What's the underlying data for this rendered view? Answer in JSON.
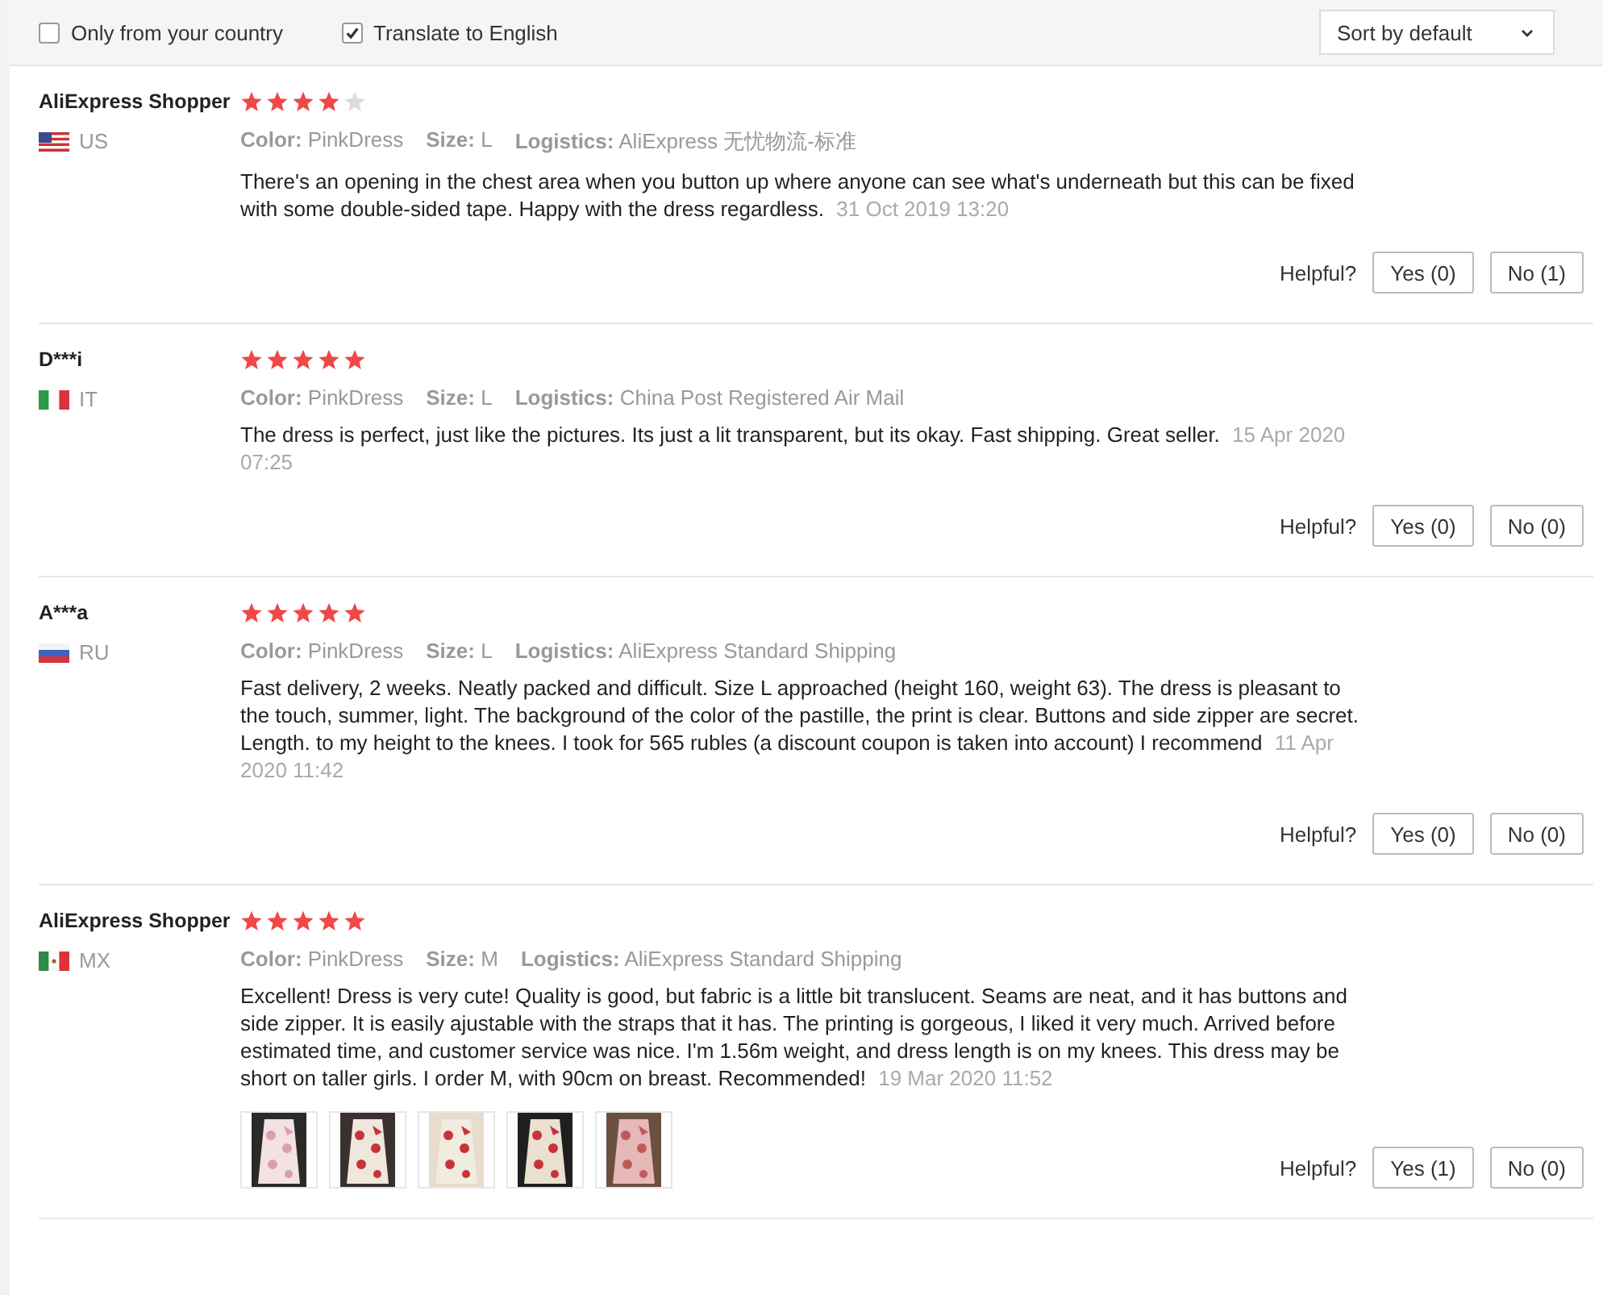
{
  "filters": [
    {
      "label": "Only from your country",
      "checked": false
    },
    {
      "label": "Translate to English",
      "checked": true
    }
  ],
  "sort": {
    "value": "Sort by default"
  },
  "reviews": [
    {
      "name": "AliExpress Shopper",
      "country": "US",
      "stars": 4,
      "details": [
        {
          "label": "Color:",
          "value": "PinkDress"
        },
        {
          "label": "Size:",
          "value": "L"
        },
        {
          "label": "Logistics:",
          "value": "AliExpress 无忧物流-标准"
        }
      ],
      "text": "There's an opening in the chest area when you button up where anyone can see what's underneath but this can be fixed with some double-sided tape. Happy with the dress regardless.",
      "date": "31 Oct 2019 13:20",
      "helpful_label": "Helpful?",
      "yes": "Yes (0)",
      "no": "No (1)"
    },
    {
      "name": "D***i",
      "country": "IT",
      "stars": 5,
      "details": [
        {
          "label": "Color:",
          "value": "PinkDress"
        },
        {
          "label": "Size:",
          "value": "L"
        },
        {
          "label": "Logistics:",
          "value": "China Post Registered Air Mail"
        }
      ],
      "text": "The dress is perfect, just like the pictures. Its just a lit transparent, but its okay. Fast shipping. Great seller.",
      "date": "15 Apr 2020 07:25",
      "helpful_label": "Helpful?",
      "yes": "Yes (0)",
      "no": "No (0)"
    },
    {
      "name": "A***a",
      "country": "RU",
      "stars": 5,
      "details": [
        {
          "label": "Color:",
          "value": "PinkDress"
        },
        {
          "label": "Size:",
          "value": "L"
        },
        {
          "label": "Logistics:",
          "value": "AliExpress Standard Shipping"
        }
      ],
      "text": "Fast delivery, 2 weeks. Neatly packed and difficult. Size L approached (height 160, weight 63). The dress is pleasant to the touch, summer, light. The background of the color of the pastille, the print is clear. Buttons and side zipper are secret. Length. to my height to the knees. I took for 565 rubles (a discount coupon is taken into account) I recommend",
      "date": "11 Apr 2020 11:42",
      "helpful_label": "Helpful?",
      "yes": "Yes (0)",
      "no": "No (0)"
    },
    {
      "name": "AliExpress Shopper",
      "country": "MX",
      "stars": 5,
      "details": [
        {
          "label": "Color:",
          "value": "PinkDress"
        },
        {
          "label": "Size:",
          "value": "M"
        },
        {
          "label": "Logistics:",
          "value": "AliExpress Standard Shipping"
        }
      ],
      "text": "Excellent! Dress is very cute! Quality is good, but fabric is a little bit translucent. Seams are neat, and it has buttons and side zipper. It is easily ajustable with the straps that it has. The printing is gorgeous, I liked it very much. Arrived before estimated time, and customer service was nice. I'm 1.56m weight, and dress length is on my knees. This dress may be short on taller girls. I order M, with 90cm on breast. Recommended!",
      "date": "19 Mar 2020 11:52",
      "photos": [
        {
          "kind": "picture"
        },
        {
          "kind": "picture"
        },
        {
          "kind": "picture"
        },
        {
          "kind": "picture"
        },
        {
          "kind": "picture"
        }
      ],
      "helpful_label": "Helpful?",
      "yes": "Yes (1)",
      "no": "No (0)"
    }
  ]
}
